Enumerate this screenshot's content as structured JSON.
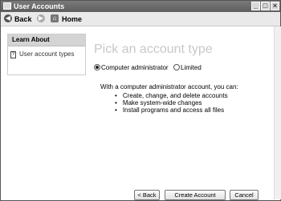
{
  "window": {
    "title": "User Accounts"
  },
  "window_controls": {
    "minimize": "_",
    "maximize": "□",
    "close": "×"
  },
  "toolbar": {
    "back_label": "Back",
    "home_label": "Home"
  },
  "sidebar": {
    "heading": "Learn About",
    "items": [
      {
        "label": "User account types"
      }
    ]
  },
  "main": {
    "title": "Pick an account type",
    "account_types": [
      {
        "label": "Computer administrator",
        "selected": true
      },
      {
        "label": "Limited",
        "selected": false
      }
    ],
    "description": "With a computer administrator account, you can:",
    "capabilities": [
      "Create, change, and delete accounts",
      "Make system-wide changes",
      "Install programs and access all files"
    ]
  },
  "buttons": {
    "back": "< Back",
    "create": "Create Account",
    "cancel": "Cancel"
  }
}
